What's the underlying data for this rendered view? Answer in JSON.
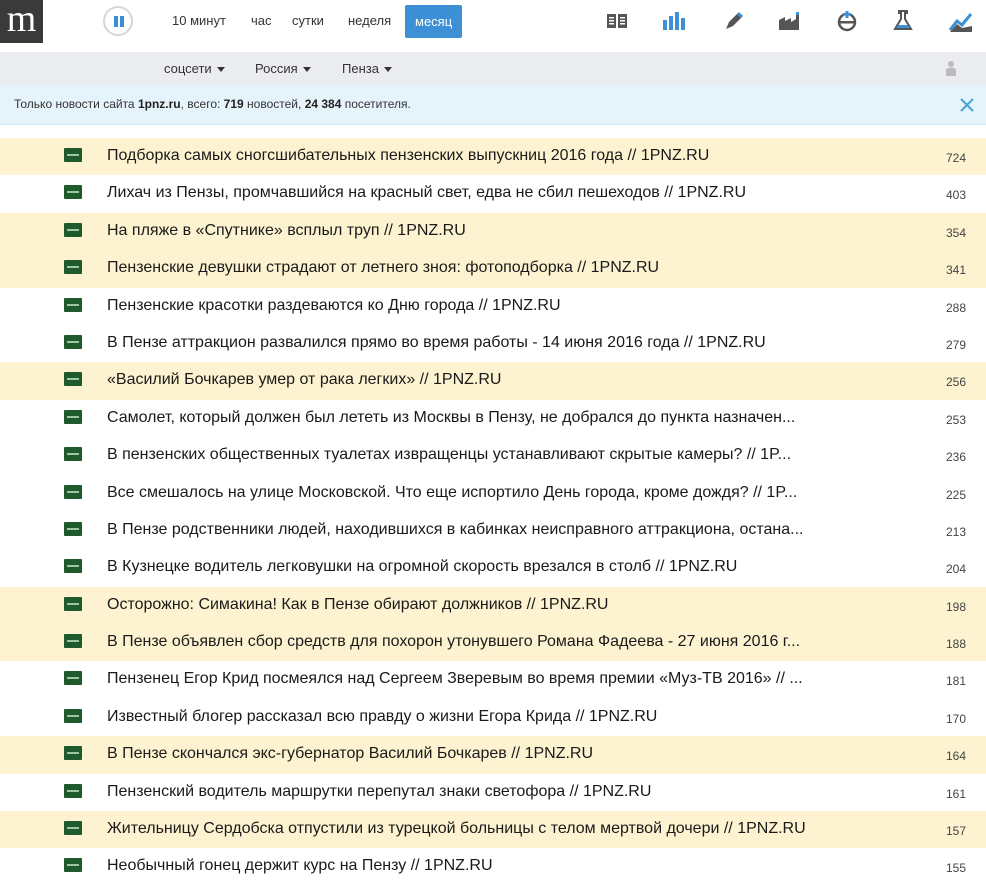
{
  "app": {
    "logo_letter": "m",
    "pause_icon": "pause-icon"
  },
  "periods": [
    {
      "label": "10 минут",
      "active": false
    },
    {
      "label": "час",
      "active": false
    },
    {
      "label": "сутки",
      "active": false
    },
    {
      "label": "неделя",
      "active": false
    },
    {
      "label": "месяц",
      "active": true
    }
  ],
  "toolbar_icons": [
    "newspaper-icon",
    "bar-chart-icon",
    "pen-icon",
    "factory-icon",
    "crown-icon",
    "flask-icon",
    "trend-line-icon"
  ],
  "filters": [
    {
      "label": "соцсети"
    },
    {
      "label": "Россия"
    },
    {
      "label": "Пенза"
    }
  ],
  "info": {
    "prefix": "Только новости сайта",
    "site": "1pnz.ru",
    "mid": ", всего:",
    "news_count": "719",
    "news_word": "новостей,",
    "visitors": "24 384",
    "visitors_word": "посетителя."
  },
  "colors": {
    "accent": "#3d8fd6",
    "highlight_row": "#fdf3d0",
    "info_bg": "#e5f3fb",
    "filter_bg": "#eaecef"
  },
  "news": [
    {
      "title": "Подборка самых сногсшибательных пензенских выпускниц 2016 года // 1PNZ.RU",
      "count": "724",
      "hl": true
    },
    {
      "title": "Лихач из Пензы, промчавшийся на красный свет, едва не сбил пешеходов // 1PNZ.RU",
      "count": "403",
      "hl": false
    },
    {
      "title": "На пляже в «Спутнике» всплыл труп // 1PNZ.RU",
      "count": "354",
      "hl": true
    },
    {
      "title": "Пензенские девушки страдают от летнего зноя: фотоподборка // 1PNZ.RU",
      "count": "341",
      "hl": true
    },
    {
      "title": "Пензенские красотки раздеваются ко Дню города // 1PNZ.RU",
      "count": "288",
      "hl": false
    },
    {
      "title": "В Пензе аттракцион развалился прямо во время работы - 14 июня 2016 года // 1PNZ.RU",
      "count": "279",
      "hl": false
    },
    {
      "title": "«Василий Бочкарев умер от рака легких» // 1PNZ.RU",
      "count": "256",
      "hl": true
    },
    {
      "title": "Самолет, который должен был лететь из Москвы в Пензу, не добрался до пункта назначен...",
      "count": "253",
      "hl": false
    },
    {
      "title": "В пензенских общественных туалетах извращенцы устанавливают скрытые камеры? // 1P...",
      "count": "236",
      "hl": false
    },
    {
      "title": "Все смешалось на улице Московской. Что еще испортило День города, кроме дождя? // 1P...",
      "count": "225",
      "hl": false
    },
    {
      "title": "В Пензе родственники людей, находившихся в кабинках неисправного аттракциона, остана...",
      "count": "213",
      "hl": false
    },
    {
      "title": "В Кузнецке водитель легковушки на огромной скорость врезался в столб // 1PNZ.RU",
      "count": "204",
      "hl": false
    },
    {
      "title": "Осторожно: Симакина! Как в Пензе обирают должников // 1PNZ.RU",
      "count": "198",
      "hl": true
    },
    {
      "title": "В Пензе объявлен сбор средств для похорон утонувшего Романа Фадеева - 27 июня 2016 г...",
      "count": "188",
      "hl": true
    },
    {
      "title": "Пензенец Егор Крид посмеялся над Сергеем Зверевым во время премии «Муз-ТВ 2016» // ...",
      "count": "181",
      "hl": false
    },
    {
      "title": "Известный блогер рассказал всю правду о жизни Егора Крида // 1PNZ.RU",
      "count": "170",
      "hl": false
    },
    {
      "title": "В Пензе скончался экс-губернатор Василий Бочкарев // 1PNZ.RU",
      "count": "164",
      "hl": true
    },
    {
      "title": "Пензенский водитель маршрутки перепутал знаки светофора // 1PNZ.RU",
      "count": "161",
      "hl": false
    },
    {
      "title": "Жительницу Сердобска отпустили из турецкой больницы с телом мертвой дочери // 1PNZ.RU",
      "count": "157",
      "hl": true
    },
    {
      "title": "Необычный гонец держит курс на Пензу // 1PNZ.RU",
      "count": "155",
      "hl": false
    }
  ]
}
